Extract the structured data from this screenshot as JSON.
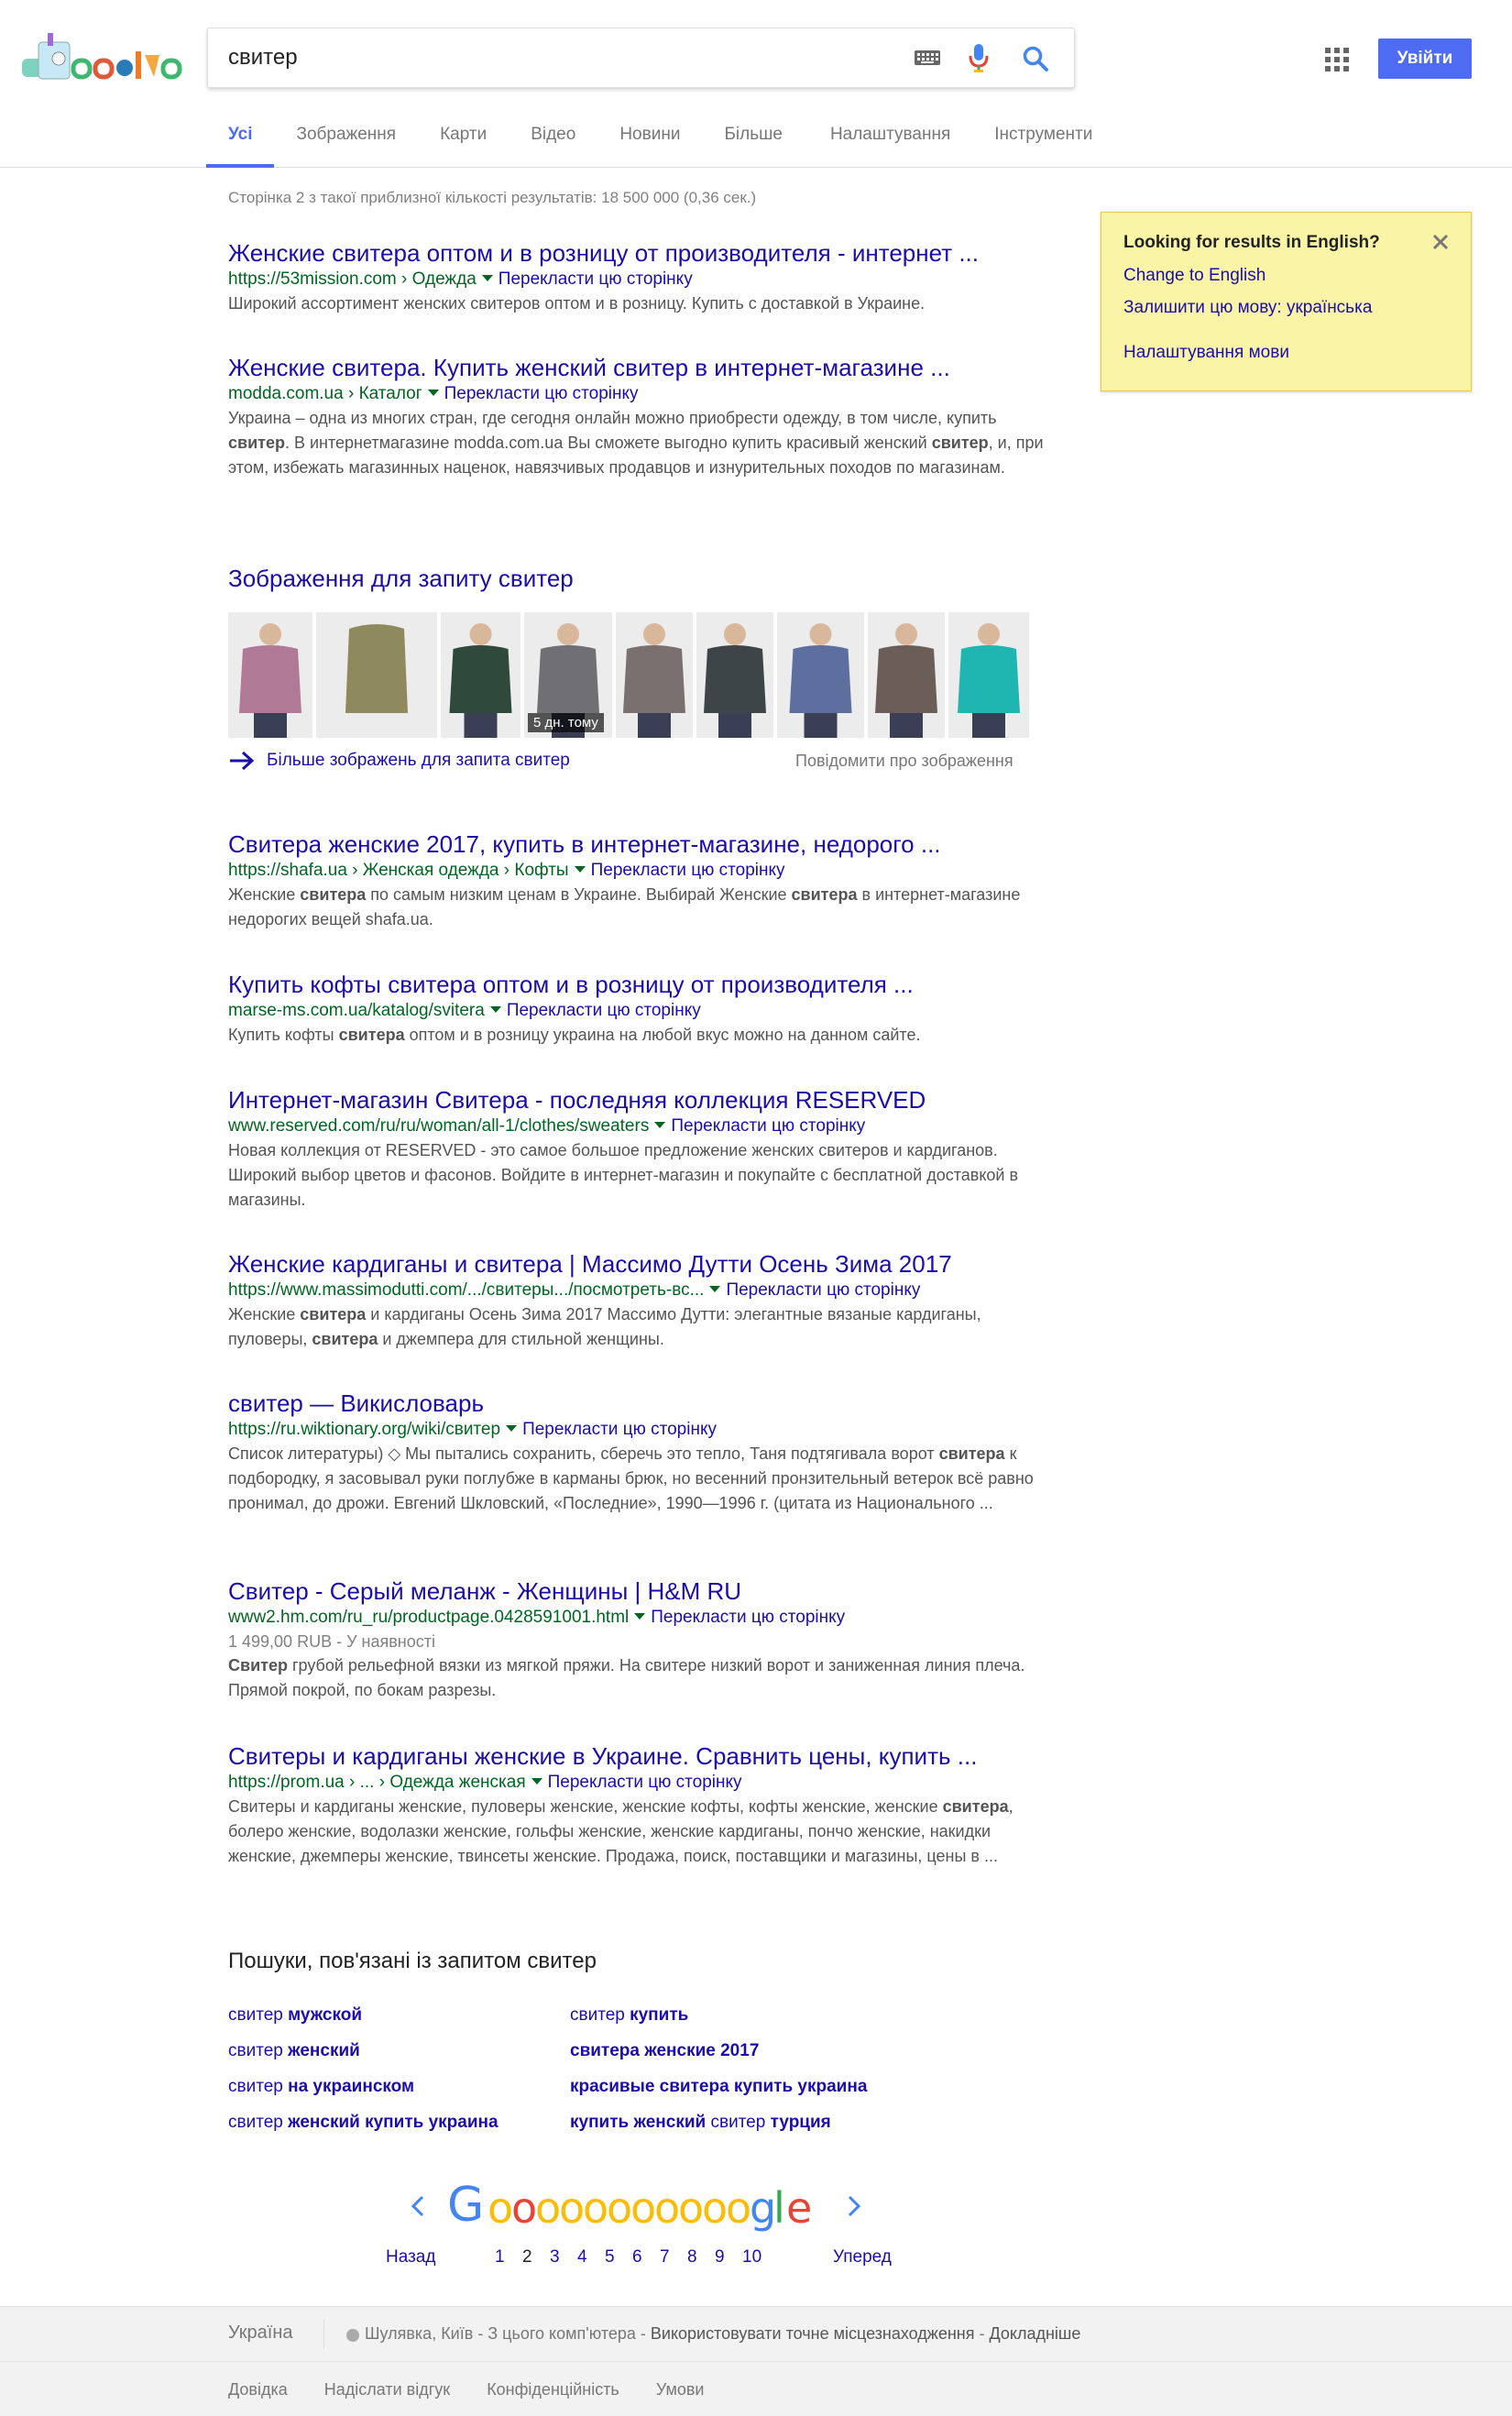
{
  "search": {
    "query": "свитер"
  },
  "header": {
    "signin_label": "Увійти"
  },
  "tabs": [
    {
      "label": "Усі",
      "active": true
    },
    {
      "label": "Зображення"
    },
    {
      "label": "Карти"
    },
    {
      "label": "Відео"
    },
    {
      "label": "Новини"
    },
    {
      "label": "Більше"
    },
    {
      "label": "Налаштування"
    },
    {
      "label": "Інструменти"
    }
  ],
  "stats": "Сторінка 2 з такої приблизної кількості результатів: 18 500 000 (0,36 сек.)",
  "translate_label": "Перекласти цю сторінку",
  "results": [
    {
      "title": "Женские свитера оптом и в розницу от производителя - интернет ...",
      "url": "https://53mission.com › Одежда",
      "snippet_html": "Широкий ассортимент женских свитеров оптом и в розницу. Купить с доставкой в Украине."
    },
    {
      "title": "Женские свитера. Купить женский свитер в интернет-магазине ...",
      "url": "modda.com.ua › Каталог",
      "snippet_html": "Украина – одна из многих стран, где сегодня онлайн можно приобрести одежду, в том числе, купить <b>свитер</b>. В интернетмагазине modda.com.ua Вы сможете выгодно купить красивый женский <b>свитер</b>, и, при этом, избежать магазинных наценок, навязчивых продавцов и изнурительных походов по магазинам."
    },
    {
      "title": "Свитера женские 2017, купить в интернет-магазине, недорого ...",
      "url": "https://shafa.ua › Женская одежда › Кофты",
      "snippet_html": "Женские <b>свитера</b> по самым низким ценам в Украине. Выбирай Женские <b>свитера</b> в интернет-магазине недорогих вещей shafa.ua."
    },
    {
      "title": "Купить кофты свитера оптом и в розницу от производителя ...",
      "url": "marse-ms.com.ua/katalog/svitera",
      "snippet_html": "Купить кофты <b>свитера</b> оптом и в розницу украина на любой вкус можно на данном сайте."
    },
    {
      "title": "Интернет-магазин Свитера - последняя коллекция RESERVED",
      "url": "www.reserved.com/ru/ru/woman/all-1/clothes/sweaters",
      "snippet_html": "Новая коллекция от RESERVED - это самое большое предложение женских свитеров и кардиганов. Широкий выбор цветов и фасонов. Войдите в интернет-магазин и покупайте с бесплатной доставкой в магазины."
    },
    {
      "title": "Женские кардиганы и свитера | Массимо Дутти Осень Зима 2017",
      "url": "https://www.massimodutti.com/.../свитеры.../посмотреть-вс...",
      "snippet_html": "Женские <b>свитера</b> и кардиганы Осень Зима 2017 Массимо Дутти: элегантные вязаные кардиганы, пуловеры, <b>свитера</b> и джемпера для стильной женщины."
    },
    {
      "title": "свитер — Викисловарь",
      "url": "https://ru.wiktionary.org/wiki/свитер",
      "snippet_html": "Список литературы) ◇ Мы пытались сохранить, сберечь это тепло, Таня подтягивала ворот <b>свитера</b> к подбородку, я засовывал руки поглубже в карманы брюк, но весенний пронзительный ветерок всё равно пронимал, до дрожи. Евгений Шкловский, «Последние», 1990—1996 г. (цитата из Национального ..."
    },
    {
      "title": "Свитер - Серый меланж - Женщины | H&M RU",
      "url": "www2.hm.com/ru_ru/productpage.0428591001.html",
      "extra": "1 499,00 RUB - У наявності",
      "snippet_html": "<b>Свитер</b> грубой рельефной вязки из мягкой пряжи. На свитере низкий ворот и заниженная линия плеча. Прямой покрой, по бокам разрезы."
    },
    {
      "title": "Свитеры и кардиганы женские в Украине. Сравнить цены, купить ...",
      "url": "https://prom.ua › ... › Одежда женская",
      "snippet_html": "Свитеры и кардиганы женские, пуловеры женские, женские кофты, кофты женские, женские <b>свитера</b>, болеро женские, водолазки женские, гольфы женские, женские кардиганы, пончо женские, накидки женские, джемперы женские, твинсеты женские. Продажа, поиск, поставщики и магазины, цены в ..."
    }
  ],
  "images": {
    "heading": "Зображення для запиту свитер",
    "badge": "5 дн. тому",
    "more_label": "Більше зображень для запита свитер",
    "report_label": "Повідомити про зображення",
    "thumbs": [
      {
        "name": "woman-mauve-turtleneck",
        "color": "#b07a96"
      },
      {
        "name": "olive-knit-sweater",
        "color": "#8f8a5e"
      },
      {
        "name": "man-deer-pattern-sweater",
        "color": "#2f4a3a"
      },
      {
        "name": "woman-grey-sweater",
        "color": "#6f6f74"
      },
      {
        "name": "man-grey-sweater",
        "color": "#7a7070"
      },
      {
        "name": "man-dark-pattern-sweater",
        "color": "#3e4548"
      },
      {
        "name": "woman-blue-sweater",
        "color": "#5d6f9e"
      },
      {
        "name": "man-brown-sweater",
        "color": "#6b5e58"
      },
      {
        "name": "man-teal-sweater",
        "color": "#1fb5b0"
      }
    ]
  },
  "related": {
    "heading": "Пошуки, пов'язані із запитом свитер",
    "items": [
      {
        "plain": "свитер ",
        "bold": "мужской",
        "suffix": ""
      },
      {
        "plain": "свитер ",
        "bold": "купить",
        "suffix": ""
      },
      {
        "plain": "свитер ",
        "bold": "женский",
        "suffix": ""
      },
      {
        "plain": "",
        "bold": "свитера женские 2017",
        "suffix": ""
      },
      {
        "plain": "свитер ",
        "bold": "на украинском",
        "suffix": ""
      },
      {
        "plain": "",
        "bold": "красивые свитера купить украина",
        "suffix": ""
      },
      {
        "plain": "свитер ",
        "bold": "женский купить украина",
        "suffix": ""
      },
      {
        "prefix_bold": "купить женский",
        "plain": " свитер ",
        "bold": "турция",
        "suffix": ""
      }
    ]
  },
  "pagination": {
    "prev_label": "Назад",
    "next_label": "Уперед",
    "current": "2",
    "pages": [
      "1",
      "2",
      "3",
      "4",
      "5",
      "6",
      "7",
      "8",
      "9",
      "10"
    ],
    "logo_letters": [
      "G",
      "o",
      "o",
      "o",
      "o",
      "o",
      "o",
      "o",
      "o",
      "o",
      "o",
      "o",
      "g",
      "l",
      "e"
    ],
    "logo_colors": [
      "#4285f4",
      "#fbbc05",
      "#ea4335",
      "#fbbc05",
      "#fbbc05",
      "#fbbc05",
      "#fbbc05",
      "#fbbc05",
      "#fbbc05",
      "#fbbc05",
      "#fbbc05",
      "#fbbc05",
      "#4285f4",
      "#34a853",
      "#ea4335"
    ]
  },
  "language_box": {
    "title": "Looking for results in English?",
    "change_label": "Change to English",
    "keep_label": "Залишити цю мову: українська",
    "settings_label": "Налаштування мови"
  },
  "footer": {
    "country": "Україна",
    "location": "Шулявка, Київ",
    "location_source": " - З цього комп'ютера - ",
    "use_precise": "Використовувати точне місцезнаходження",
    "dash": " - ",
    "more": "Докладніше",
    "links": [
      "Довідка",
      "Надіслати відгук",
      "Конфіденційність",
      "Умови"
    ]
  }
}
